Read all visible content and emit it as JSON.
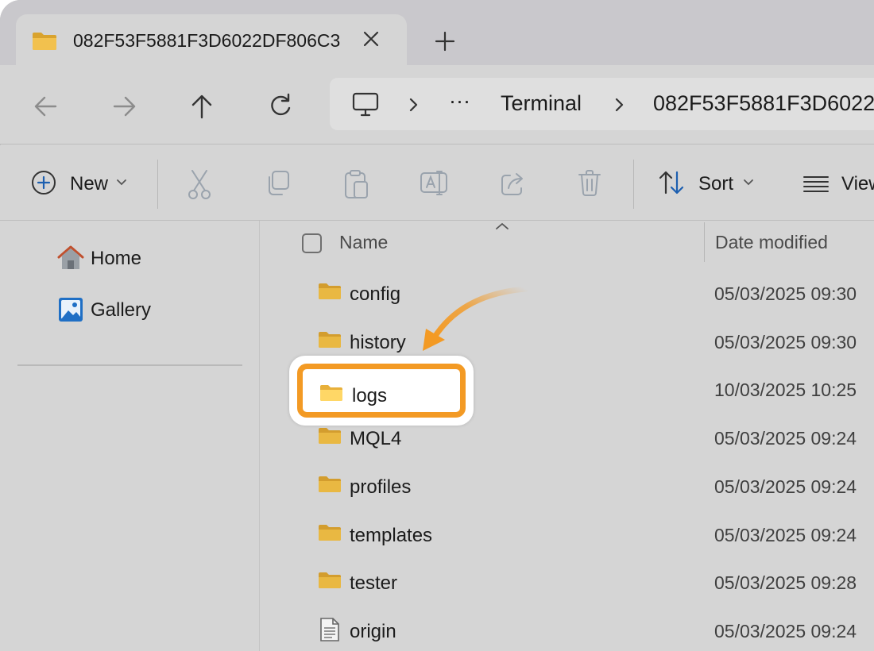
{
  "tab": {
    "title": "082F53F5881F3D6022DF806C3"
  },
  "address": {
    "ellipsis": "···",
    "crumbs": [
      "Terminal",
      "082F53F5881F3D6022"
    ]
  },
  "command_bar": {
    "new_label": "New",
    "sort_label": "Sort",
    "view_label": "View"
  },
  "nav_pane": {
    "items": [
      {
        "label": "Home",
        "icon": "home-icon"
      },
      {
        "label": "Gallery",
        "icon": "gallery-icon"
      }
    ]
  },
  "columns": {
    "name": "Name",
    "date_modified": "Date modified"
  },
  "files": [
    {
      "name": "config",
      "date": "05/03/2025 09:30",
      "type": "folder"
    },
    {
      "name": "history",
      "date": "05/03/2025 09:30",
      "type": "folder"
    },
    {
      "name": "logs",
      "date": "10/03/2025 10:25",
      "type": "folder",
      "highlighted": true
    },
    {
      "name": "MQL4",
      "date": "05/03/2025 09:24",
      "type": "folder"
    },
    {
      "name": "profiles",
      "date": "05/03/2025 09:24",
      "type": "folder"
    },
    {
      "name": "templates",
      "date": "05/03/2025 09:24",
      "type": "folder"
    },
    {
      "name": "tester",
      "date": "05/03/2025 09:28",
      "type": "folder"
    },
    {
      "name": "origin",
      "date": "05/03/2025 09:24",
      "type": "file"
    }
  ],
  "colors": {
    "highlight": "#f39a24",
    "folder": "#e3b341",
    "chrome": "#d5d5d5"
  }
}
